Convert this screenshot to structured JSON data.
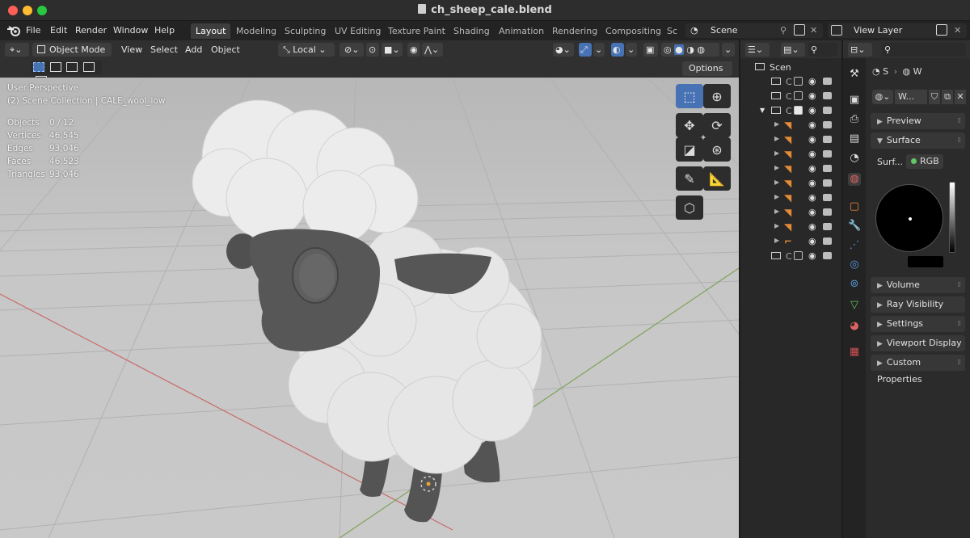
{
  "window": {
    "title": "ch_sheep_cale.blend"
  },
  "menu": [
    "File",
    "Edit",
    "Render",
    "Window",
    "Help"
  ],
  "workspaces": [
    "Layout",
    "Modeling",
    "Sculpting",
    "UV Editing",
    "Texture Paint",
    "Shading",
    "Animation",
    "Rendering",
    "Compositing",
    "Sc"
  ],
  "active_workspace": "Layout",
  "scene": {
    "name": "Scene"
  },
  "view_layer": {
    "name": "View Layer"
  },
  "viewport_header": {
    "mode": "Object Mode",
    "menus": [
      "View",
      "Select",
      "Add",
      "Object"
    ],
    "transform_orientation": "Local"
  },
  "viewport": {
    "perspective_label": "User Perspective",
    "collection_label": "(2) Scene Collection | CALE_wool_low",
    "stats": [
      {
        "label": "Objects",
        "value": "0 / 12"
      },
      {
        "label": "Vertices",
        "value": "46,545"
      },
      {
        "label": "Edges",
        "value": "93,046"
      },
      {
        "label": "Faces",
        "value": "46,523"
      },
      {
        "label": "Triangles",
        "value": "93,046"
      }
    ],
    "options_label": "Options"
  },
  "outliner": {
    "root_label": "Scen",
    "collections": [
      {
        "label": "C",
        "checked": false
      },
      {
        "label": "C",
        "checked": false
      },
      {
        "label": "C",
        "checked": true
      },
      {
        "label": "C",
        "checked": false
      }
    ]
  },
  "properties": {
    "breadcrumb_scene": "S",
    "breadcrumb_world": "W",
    "world_name": "W...",
    "panels": {
      "preview": "Preview",
      "surface": "Surface",
      "volume": "Volume",
      "ray_visibility": "Ray Visibility",
      "settings": "Settings",
      "viewport_display": "Viewport Display",
      "custom_properties": "Custom Properties"
    },
    "surface_label": "Surf...",
    "surface_value": "RGB",
    "colors": {
      "accent": "#4772b3",
      "bone": "#e58a36",
      "socket": "#63c763"
    }
  }
}
